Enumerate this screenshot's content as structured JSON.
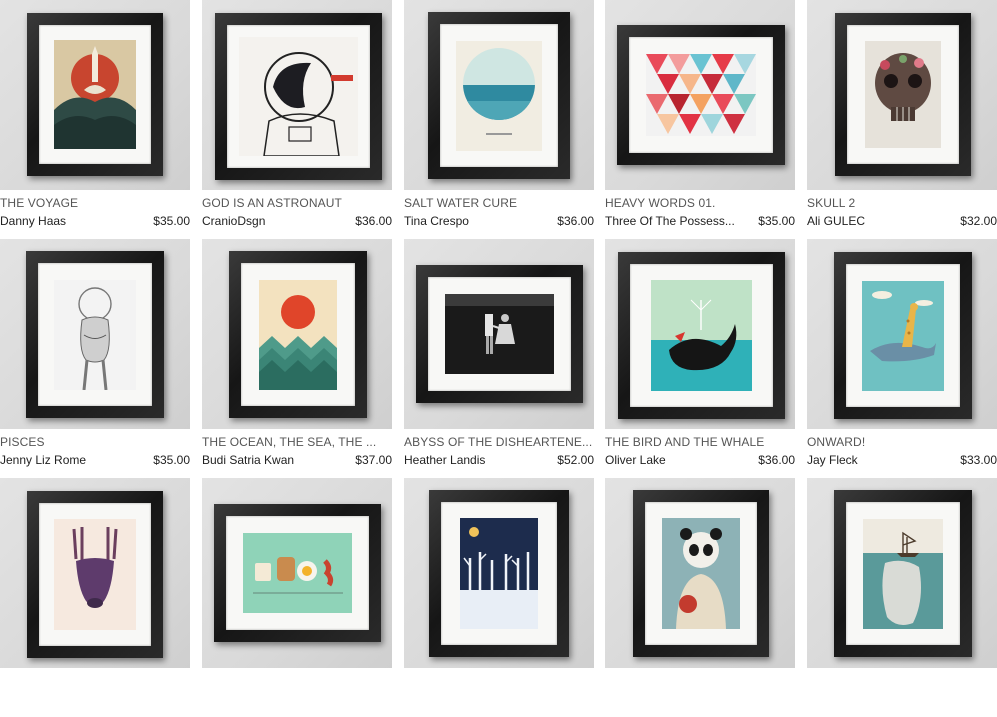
{
  "items": [
    {
      "title": "THE VOYAGE",
      "artist": "Danny Haas",
      "price": "$35.00",
      "art": "voyage-rocket-icon"
    },
    {
      "title": "GOD IS AN ASTRONAUT",
      "artist": "CranioDsgn",
      "price": "$36.00",
      "art": "astronaut-helmet-icon"
    },
    {
      "title": "SALT WATER CURE",
      "artist": "Tina Crespo",
      "price": "$36.00",
      "art": "ocean-circle-icon"
    },
    {
      "title": "HEAVY WORDS 01.",
      "artist": "Three Of The Possess...",
      "price": "$35.00",
      "art": "geometric-triangles-icon"
    },
    {
      "title": "SKULL 2",
      "artist": "Ali GULEC",
      "price": "$32.00",
      "art": "flower-skull-icon"
    },
    {
      "title": "PISCES",
      "artist": "Jenny Liz Rome",
      "price": "$35.00",
      "art": "fishbowl-woman-icon"
    },
    {
      "title": "THE OCEAN, THE SEA, THE ...",
      "artist": "Budi Satria Kwan",
      "price": "$37.00",
      "art": "sun-over-sea-icon"
    },
    {
      "title": "ABYSS OF THE DISHEARTENE...",
      "artist": "Heather Landis",
      "price": "$52.00",
      "art": "couple-underwater-icon"
    },
    {
      "title": "THE BIRD AND THE WHALE",
      "artist": "Oliver Lake",
      "price": "$36.00",
      "art": "bird-and-whale-icon"
    },
    {
      "title": "ONWARD!",
      "artist": "Jay Fleck",
      "price": "$33.00",
      "art": "giraffe-on-whale-icon"
    },
    {
      "title": "",
      "artist": "",
      "price": "",
      "art": "moose-icon"
    },
    {
      "title": "",
      "artist": "",
      "price": "",
      "art": "breakfast-friends-icon"
    },
    {
      "title": "",
      "artist": "",
      "price": "",
      "art": "snowy-forest-icon"
    },
    {
      "title": "",
      "artist": "",
      "price": "",
      "art": "panda-astronaut-icon"
    },
    {
      "title": "",
      "artist": "",
      "price": "",
      "art": "whale-and-ship-icon"
    }
  ]
}
